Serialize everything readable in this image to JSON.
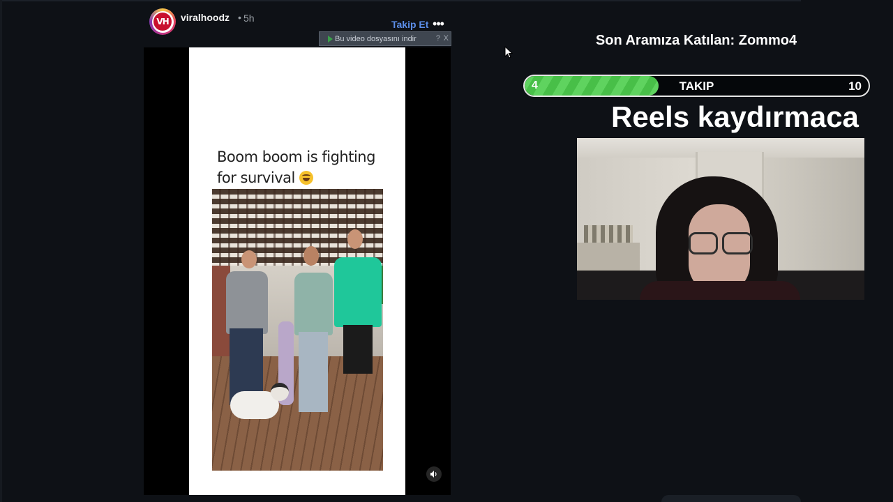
{
  "post": {
    "username": "viralhoodz",
    "dot": "•",
    "time": "5h",
    "follow_label": "Takip Et",
    "more_icon": "more-horizontal-icon",
    "avatar_logo_text": "VH"
  },
  "download_bar": {
    "label": "Bu video dosyasını indir",
    "help": "?",
    "close": "X"
  },
  "video": {
    "caption": "Boom boom is fighting for survival",
    "emoji": "laughing-emoji",
    "sound_icon": "speaker-icon"
  },
  "overlay": {
    "last_follower": "Son Aramıza Katılan: Zommo4",
    "goal": {
      "current": "4",
      "label": "TAKIP",
      "target": "10",
      "progress": 0.39
    },
    "title": "Reels kaydırmaca",
    "goal_fill_color": "#5fd35f"
  },
  "colors": {
    "background": "#0e1116",
    "link": "#5c8ee8"
  }
}
